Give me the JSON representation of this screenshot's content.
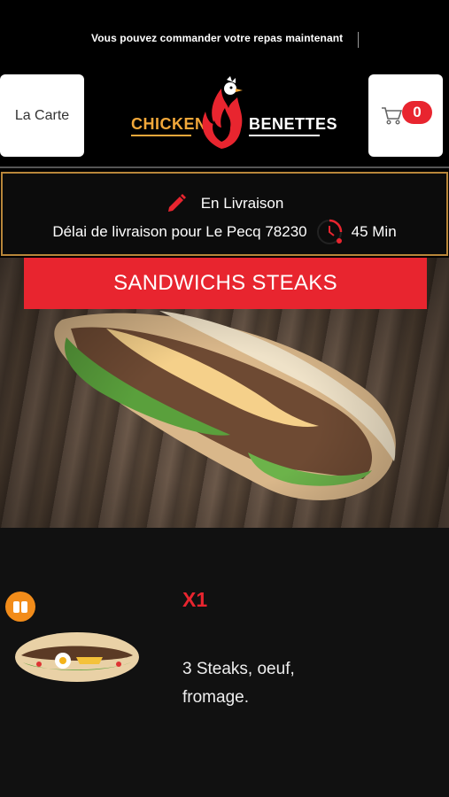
{
  "ticker": {
    "text": "Vous pouvez commander votre repas maintenant"
  },
  "header": {
    "menu_label": "La Carte",
    "brand_left": "CHICKEN",
    "brand_right": "BENETTES",
    "cart_count": "0"
  },
  "delivery": {
    "mode": "En Livraison",
    "delay_text": "Délai de livraison pour Le Pecq 78230",
    "delay_value": "45 Min"
  },
  "category": {
    "title": "SANDWICHS STEAKS"
  },
  "product": {
    "quantity": "X1",
    "description": "3 Steaks, oeuf, fromage."
  },
  "colors": {
    "accent": "#e8252f",
    "brand_orange": "#f2a83a",
    "border_gold": "#b8863a"
  },
  "icons": {
    "pencil": "pencil-icon",
    "clock": "clock-icon",
    "cart": "cart-icon",
    "badge": "vegetarian-badge-icon"
  }
}
